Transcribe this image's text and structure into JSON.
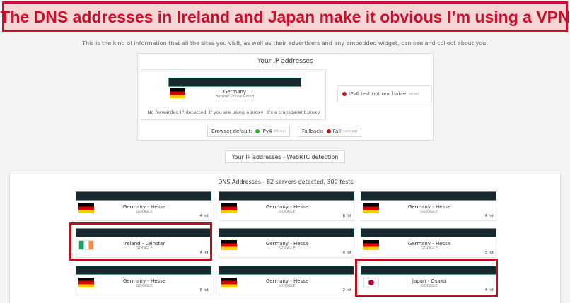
{
  "banner": {
    "text": "The DNS addresses in Ireland and Japan make it obvious I’m using a VPN"
  },
  "intro": "This is the kind of information that all the sites you visit, as well as their advertisers and any embedded widget, can see and collect about you.",
  "ip_panel": {
    "title": "Your IP addresses",
    "ip": {
      "country": "Germany",
      "isp": "Hetzner Online GmbH",
      "flag": "flag-germany-icon"
    },
    "no_forward": "No forwarded IP detected. If you are using a proxy, it's a transparent proxy.",
    "ipv6": {
      "text": "IPv6 test not reachable.",
      "note": "(error)"
    },
    "browser_default": {
      "label": "Browser default:",
      "value": "IPv4",
      "note": "(69 ms)",
      "status_color": "#2fb52f"
    },
    "fallback": {
      "label": "Fallback:",
      "value": "Fail",
      "note": "(timeout)",
      "status_color": "#c41616"
    }
  },
  "webrtc_button": {
    "label": "Your IP addresses - WebRTC detection"
  },
  "dns": {
    "title": "DNS Addresses - 82 servers detected, 300 tests",
    "cards": [
      {
        "location": "Germany - Hesse",
        "provider": "GOOGLE",
        "hits": "4 hit",
        "flag": "flag-germany-icon"
      },
      {
        "location": "Germany - Hesse",
        "provider": "GOOGLE",
        "hits": "6 hit",
        "flag": "flag-germany-icon"
      },
      {
        "location": "Germany - Hesse",
        "provider": "GOOGLE",
        "hits": "4 hit",
        "flag": "flag-germany-icon"
      },
      {
        "location": "Ireland - Leinster",
        "provider": "GOOGLE",
        "hits": "4 hit",
        "flag": "flag-ireland-icon"
      },
      {
        "location": "Germany - Hesse",
        "provider": "GOOGLE",
        "hits": "4 hit",
        "flag": "flag-germany-icon"
      },
      {
        "location": "Germany - Hesse",
        "provider": "GOOGLE",
        "hits": "5 hit",
        "flag": "flag-germany-icon"
      },
      {
        "location": "Germany - Hesse",
        "provider": "GOOGLE",
        "hits": "6 hit",
        "flag": "flag-germany-icon"
      },
      {
        "location": "Germany - Hesse",
        "provider": "GOOGLE",
        "hits": "2 hit",
        "flag": "flag-germany-icon"
      },
      {
        "location": "Japan - Ōsaka",
        "provider": "GOOGLE",
        "hits": "4 hit",
        "flag": "flag-japan-icon"
      }
    ]
  },
  "colors": {
    "accent_red": "#c8102e",
    "highlight_red": "#b5121b",
    "redacted_bar": "#17292e"
  }
}
